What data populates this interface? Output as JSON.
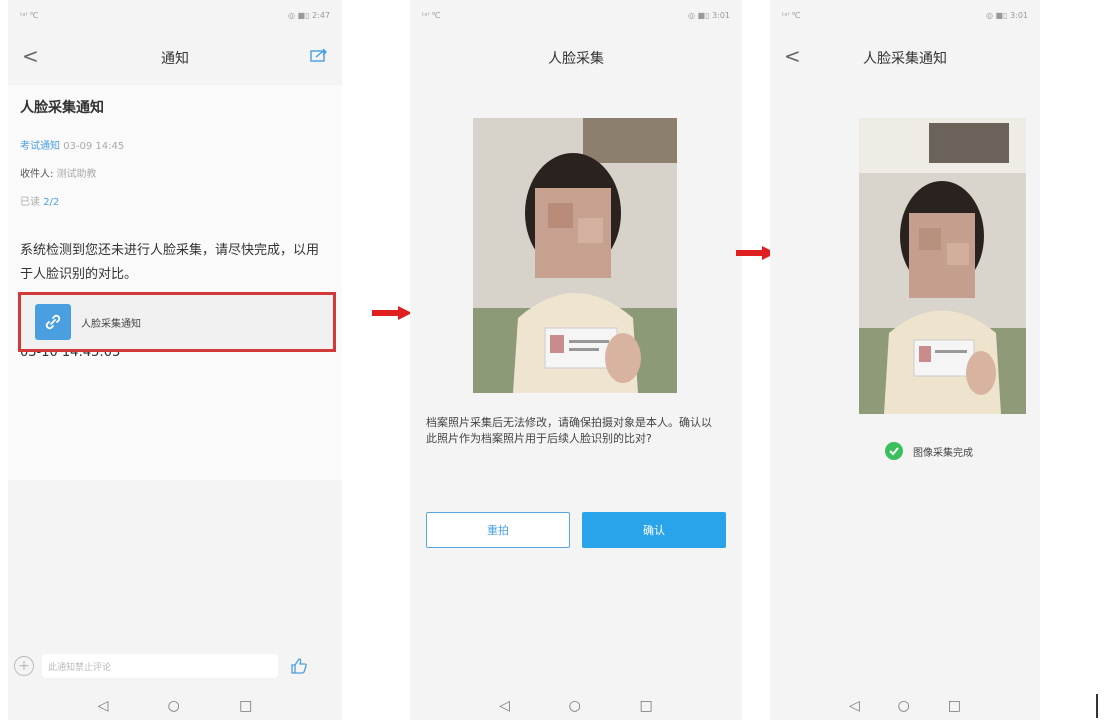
{
  "phone1": {
    "status_left": "ᵗᵃˡ ℃",
    "status_right": "◎ ■▯ 2:47",
    "nav_title": "通知",
    "notice_title": "人脸采集通知",
    "meta_tag": "考试通知",
    "meta_time": "03-09 14:45",
    "recipient_label": "收件人:",
    "recipient_value": "测试助教",
    "read_label": "已读",
    "read_value": "2/2",
    "message": "系统检测到您还未进行人脸采集，请尽快完成，以用于人脸识别的对比。",
    "validity": "此链接采集有效期：2022-03-09 14:45:03 - 2022-03-10 14:45:03",
    "link_text": "人脸采集通知",
    "comment_placeholder": "此通知禁止评论"
  },
  "phone2": {
    "status_left": "ᵗᵃˡ ℃",
    "status_right": "◎ ■▯ 3:01",
    "nav_title": "人脸采集",
    "prompt": "档案照片采集后无法修改，请确保拍摄对象是本人。确认以此照片作为档案照片用于后续人脸识别的比对?",
    "retake_label": "重拍",
    "confirm_label": "确认"
  },
  "phone3": {
    "status_left": "ᵗᵃˡ ℃",
    "status_right": "◎ ■▯ 3:01",
    "nav_title": "人脸采集通知",
    "done_text": "图像采集完成"
  },
  "system_nav": {
    "back": "◁",
    "home": "○",
    "recent": "□"
  },
  "colors": {
    "accent": "#29a3ea",
    "highlight": "#d23a3a",
    "arrow": "#e02020",
    "success": "#3cbf5c"
  }
}
